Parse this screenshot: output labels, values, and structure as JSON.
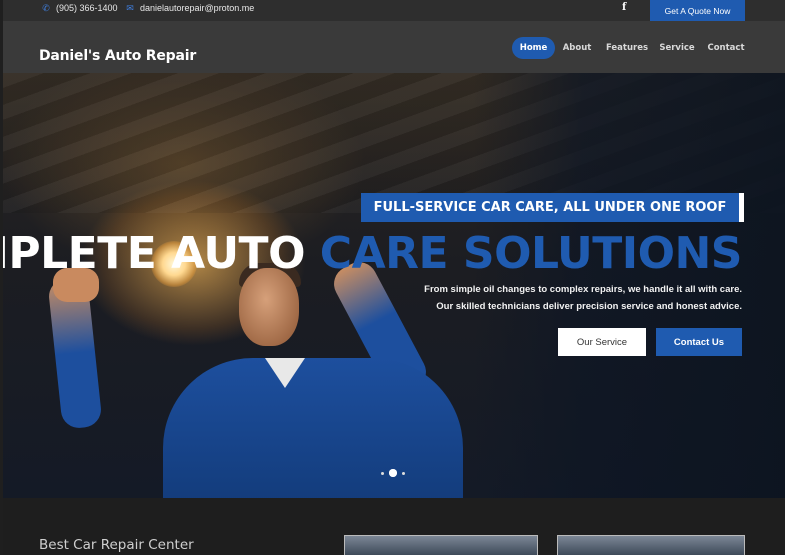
{
  "topbar": {
    "phone": "(905) 366-1400",
    "email": "danielautorepair@proton.me",
    "social_icon": "facebook-icon",
    "quote_button": "Get A Quote Now"
  },
  "header": {
    "brand": "Daniel's Auto Repair",
    "nav": [
      {
        "label": "Home",
        "active": true
      },
      {
        "label": "About"
      },
      {
        "label": "Features"
      },
      {
        "label": "Service"
      },
      {
        "label": "Contact"
      }
    ]
  },
  "hero": {
    "tagline": "FULL-SERVICE CAR CARE, ALL UNDER ONE ROOF",
    "headline_white": "OMPLETE AUTO ",
    "headline_blue": "CARE SOLUTIONS",
    "line1": "From simple oil changes to complex repairs, we handle it all with care.",
    "line2": "Our skilled technicians deliver precision service and honest advice.",
    "btn_service": "Our Service",
    "btn_contact": "Contact Us"
  },
  "section": {
    "title": "Best Car Repair Center"
  },
  "colors": {
    "accent": "#1f5bb0",
    "topbar": "#2e2e2e",
    "header": "#3a3a3a"
  }
}
